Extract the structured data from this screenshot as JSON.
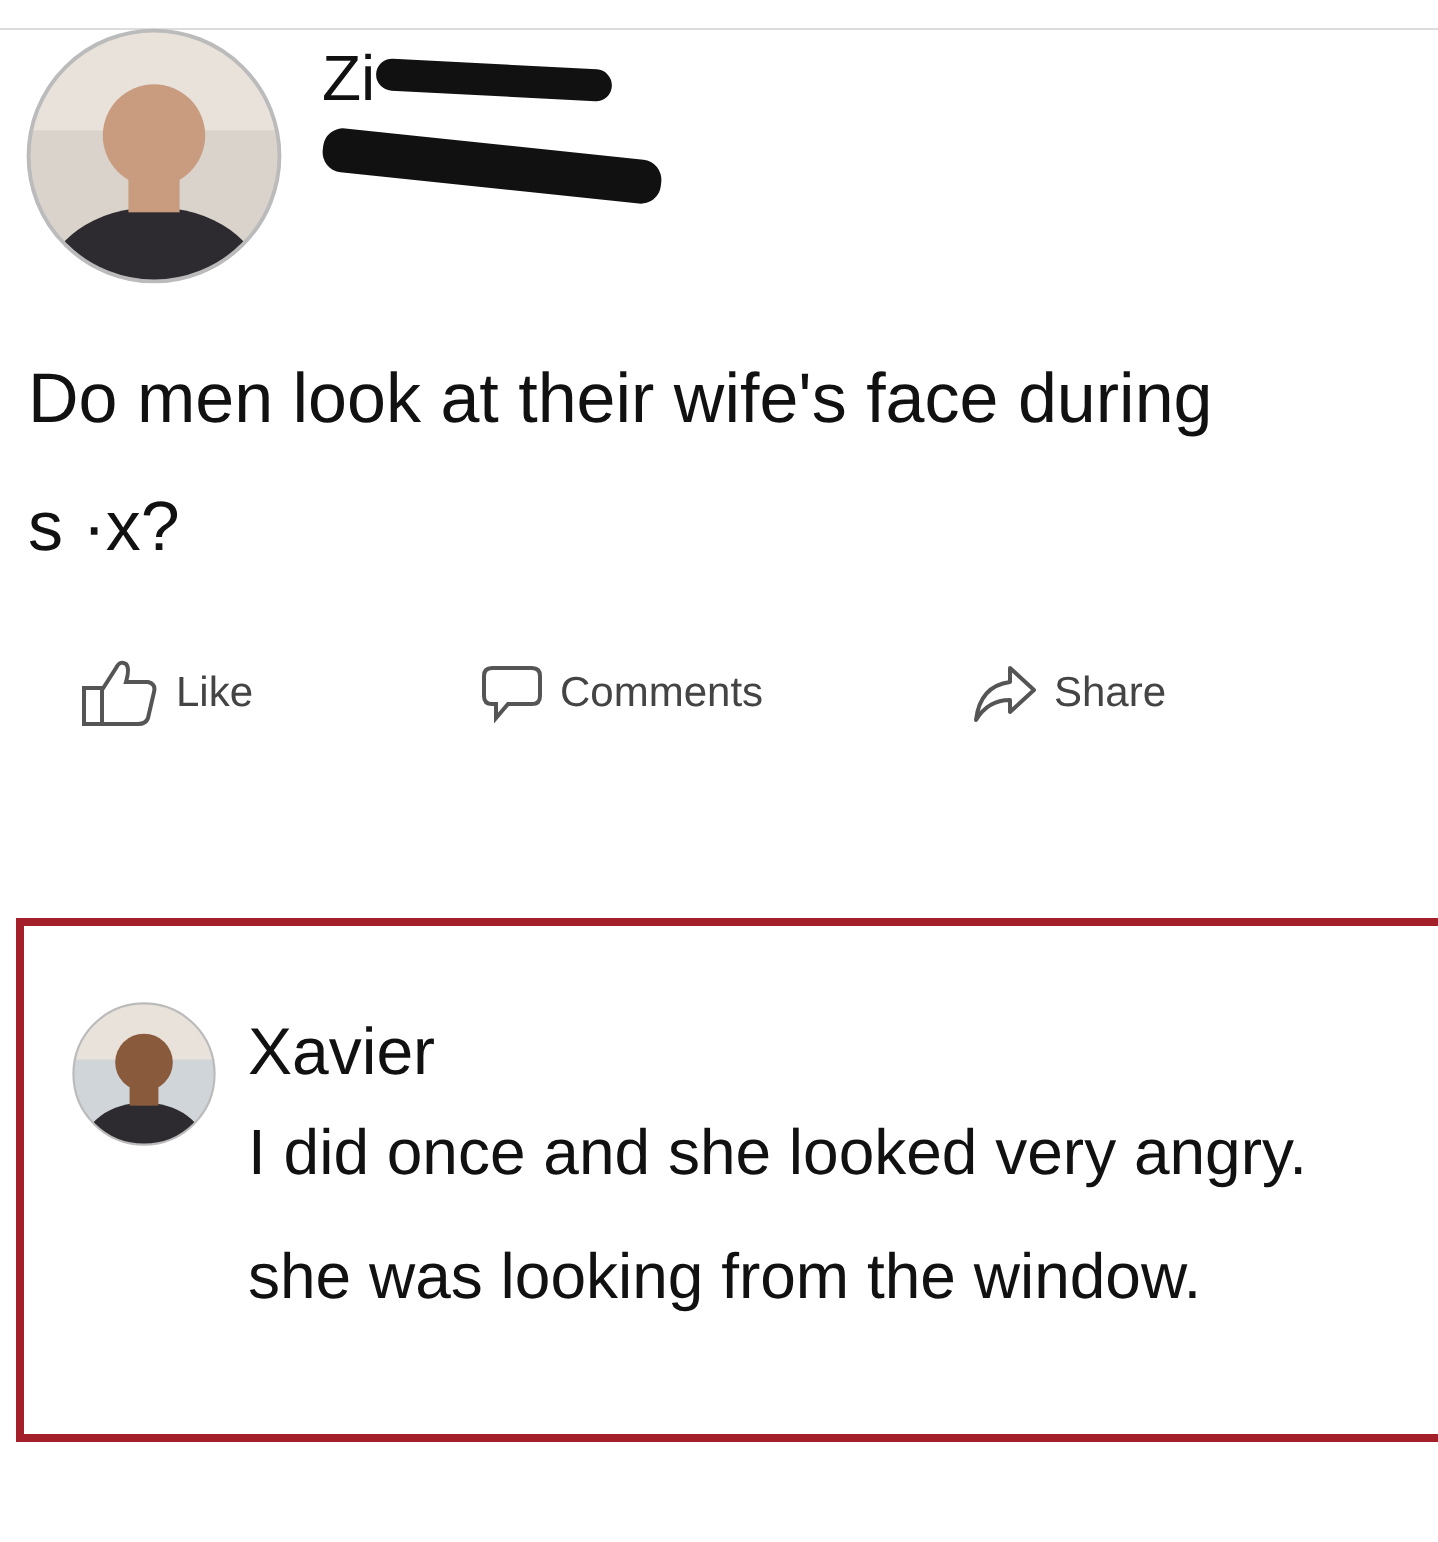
{
  "post": {
    "author": {
      "name": "Zi"
    },
    "text": "Do men look at their wife's face during",
    "text_line_2": "s ·x?",
    "actions": [
      {
        "kind": "like",
        "label": "Like"
      },
      {
        "kind": "comment",
        "label": "Comments"
      },
      {
        "kind": "share",
        "label": "Share"
      }
    ]
  },
  "comment": {
    "author": "Xavier",
    "lines": [
      "I did once and she looked very angry.",
      "she was looking from the window."
    ]
  }
}
